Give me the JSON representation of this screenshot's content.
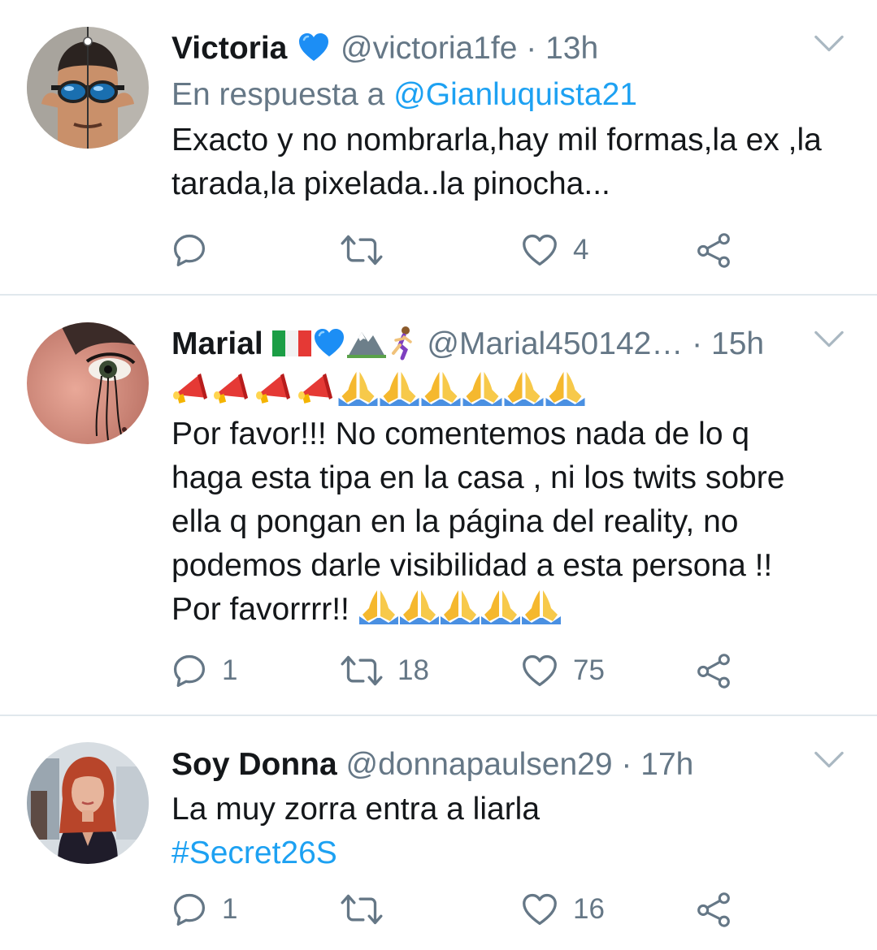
{
  "colors": {
    "link": "#1da1f2",
    "secondary": "#657786",
    "text": "#14171a",
    "divider": "#e1e8ed"
  },
  "tweets": [
    {
      "name": "Victoria",
      "name_emojis": [
        "blue-heart"
      ],
      "handle": "@victoria1fe",
      "separator": "·",
      "time": "13h",
      "reply_prefix": "En respuesta a",
      "reply_to": "@Gianluquista21",
      "text": "Exacto y no nombrarla,hay mil formas,la ex ,la tarada,la pixelada..la pinocha...",
      "replies": "",
      "retweets": "",
      "likes": "4",
      "avatar": "man-with-swim-goggles"
    },
    {
      "name": "Marial",
      "name_emojis": [
        "italy-flag",
        "blue-heart",
        "mountain",
        "woman-running"
      ],
      "handle": "@Marial450142…",
      "separator": "·",
      "time": "15h",
      "emoji_line": [
        "megaphone",
        "megaphone",
        "megaphone",
        "megaphone",
        "folded-hands",
        "folded-hands",
        "folded-hands",
        "folded-hands",
        "folded-hands",
        "folded-hands"
      ],
      "text": "Por favor!!!  No comentemos nada de lo q haga esta tipa en la casa , ni los twits sobre ella q pongan en la página del reality, no podemos darle visibilidad a esta persona !!",
      "text_last": "Por favorrrr!!",
      "text_last_emojis": [
        "folded-hands",
        "folded-hands",
        "folded-hands",
        "folded-hands",
        "folded-hands"
      ],
      "replies": "1",
      "retweets": "18",
      "likes": "75",
      "avatar": "close-up-eye"
    },
    {
      "name": "Soy Donna",
      "handle": "@donnapaulsen29",
      "separator": "·",
      "time": "17h",
      "text": "La muy zorra entra a liarla",
      "hashtag": "#Secret26S",
      "replies": "1",
      "retweets": "",
      "likes": "16",
      "avatar": "red-haired-woman"
    }
  ],
  "icons": {
    "reply": "reply-bubble-icon",
    "retweet": "retweet-arrows-icon",
    "like": "heart-outline-icon",
    "share": "share-nodes-icon",
    "menu": "chevron-down-icon"
  }
}
